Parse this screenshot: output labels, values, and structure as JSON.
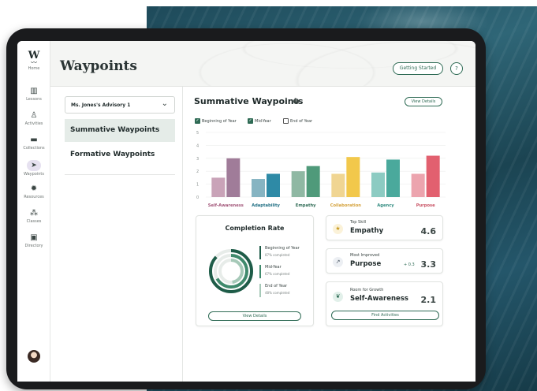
{
  "app": {
    "logo": "W",
    "home_label": "Home",
    "page_title": "Waypoints"
  },
  "rail": {
    "items": [
      {
        "label": "Lessons",
        "icon": "book-icon"
      },
      {
        "label": "Activities",
        "icon": "hiker-icon"
      },
      {
        "label": "Collections",
        "icon": "folder-icon"
      },
      {
        "label": "Waypoints",
        "icon": "navigation-arrow-icon",
        "active": true
      },
      {
        "label": "Resources",
        "icon": "lightbulb-icon"
      },
      {
        "label": "Classes",
        "icon": "people-icon"
      },
      {
        "label": "Directory",
        "icon": "contact-book-icon"
      }
    ]
  },
  "header": {
    "getting_started": "Getting Started",
    "help": "?"
  },
  "advisory_select": {
    "value": "Ms. Jones's Advisory 1"
  },
  "nav": {
    "summative": "Summative Waypoints",
    "formative": "Formative Waypoints"
  },
  "summary": {
    "title": "Summative Waypoints",
    "view_details": "View Details",
    "legend": [
      {
        "label": "Beginning of Year",
        "checked": true
      },
      {
        "label": "Mid-Year",
        "checked": true
      },
      {
        "label": "End of Year",
        "checked": false
      }
    ]
  },
  "chart_data": {
    "type": "bar",
    "categories": [
      "Self-Awareness",
      "Adaptability",
      "Empathy",
      "Collaboration",
      "Agency",
      "Purpose"
    ],
    "category_colors": [
      "#a3577a",
      "#1f6e83",
      "#2f6b55",
      "#d4a13a",
      "#2f8a7f",
      "#c85062"
    ],
    "series": [
      {
        "values": [
          1.5,
          1.4,
          2.0,
          1.8,
          1.9,
          1.8
        ]
      },
      {
        "values": [
          3.0,
          1.8,
          2.4,
          3.1,
          2.9,
          3.2
        ]
      }
    ],
    "series_colors": [
      [
        "#c9a3b8",
        "#86b4c2",
        "#8fb8a3",
        "#f0d592",
        "#8ccbc2",
        "#eca4ae"
      ],
      [
        "#a07c99",
        "#2e8aa6",
        "#4f9a7a",
        "#f2c84b",
        "#4aa99c",
        "#e2606f"
      ]
    ],
    "y_ticks": [
      0,
      1,
      2,
      3,
      4,
      5
    ],
    "ylim": [
      0,
      5
    ],
    "grid": true
  },
  "completion": {
    "title": "Completion Rate",
    "items": [
      {
        "name": "Beginning of Year",
        "pct_text": "87% completed",
        "pct": 0.87,
        "color": "#1e5c48"
      },
      {
        "name": "Mid-Year",
        "pct_text": "67% completed",
        "pct": 0.67,
        "color": "#3f8a6c"
      },
      {
        "name": "End of Year",
        "pct_text": "48% completed",
        "pct": 0.48,
        "color": "#a6c9b8"
      }
    ],
    "view_details": "View Details"
  },
  "stats": {
    "top_skill": {
      "label": "Top Skill",
      "name": "Empathy",
      "value": "4.6",
      "icon": "star-icon"
    },
    "most_improved": {
      "label": "Most Improved",
      "name": "Purpose",
      "delta": "+ 0.3",
      "value": "3.3",
      "icon": "trend-up-icon"
    },
    "growth": {
      "label": "Room for Growth",
      "name": "Self-Awareness",
      "value": "2.1",
      "icon": "sprout-icon"
    },
    "find_activities": "Find Activities"
  }
}
